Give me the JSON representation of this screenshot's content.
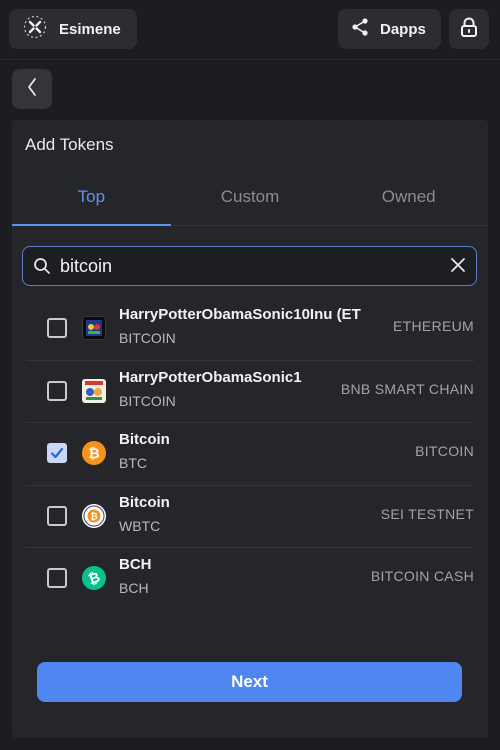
{
  "header": {
    "account_label": "Esimene",
    "dapps_label": "Dapps"
  },
  "panel": {
    "title": "Add Tokens",
    "tabs": [
      {
        "label": "Top",
        "active": true
      },
      {
        "label": "Custom",
        "active": false
      },
      {
        "label": "Owned",
        "active": false
      }
    ]
  },
  "search": {
    "value": "bitcoin",
    "placeholder": ""
  },
  "tokens": [
    {
      "name": "HarryPotterObamaSonic10Inu (ET",
      "symbol": "BITCOIN",
      "network": "ETHEREUM",
      "checked": false,
      "icon": "hpos-eth-icon"
    },
    {
      "name": "HarryPotterObamaSonic1",
      "symbol": "BITCOIN",
      "network": "BNB SMART CHAIN",
      "checked": false,
      "icon": "hpos-bnb-icon"
    },
    {
      "name": "Bitcoin",
      "symbol": "BTC",
      "network": "BITCOIN",
      "checked": true,
      "icon": "bitcoin-icon"
    },
    {
      "name": "Bitcoin",
      "symbol": "WBTC",
      "network": "SEI TESTNET",
      "checked": false,
      "icon": "wbtc-icon"
    },
    {
      "name": "BCH",
      "symbol": "BCH",
      "network": "BITCOIN CASH",
      "checked": false,
      "icon": "bitcoin-cash-icon"
    }
  ],
  "footer": {
    "next_label": "Next"
  },
  "colors": {
    "accent": "#5b93f4",
    "button": "#4d87ef",
    "background": "#1c1d20",
    "panel": "#25262a",
    "bitcoin": "#f7931a",
    "bitcoin_cash": "#0ac18e"
  }
}
